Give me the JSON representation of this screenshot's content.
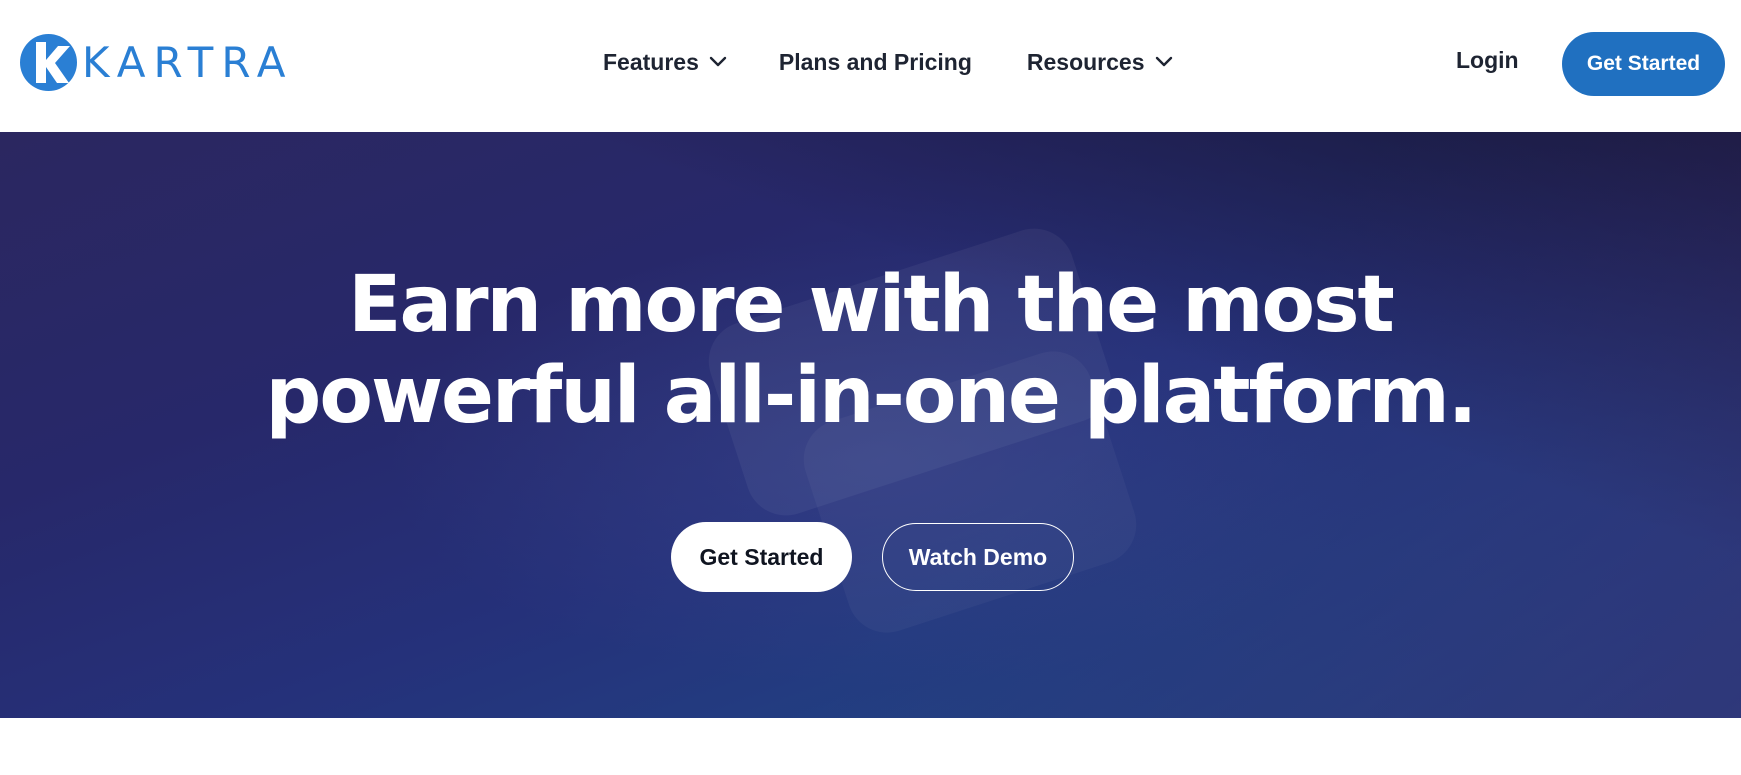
{
  "brand": {
    "name": "KARTRA",
    "color": "#2a7fd4"
  },
  "nav": {
    "features": "Features",
    "pricing": "Plans and Pricing",
    "resources": "Resources"
  },
  "header": {
    "login": "Login",
    "cta": "Get Started",
    "cta_color": "#2070c0"
  },
  "hero": {
    "title_line1": "Earn more with the most",
    "title_line2": "powerful all-in-one platform.",
    "primary_cta": "Get Started",
    "secondary_cta": "Watch Demo"
  },
  "icons": {
    "logo": "kartra-k-logo-icon",
    "dropdown": "chevron-down-icon"
  }
}
